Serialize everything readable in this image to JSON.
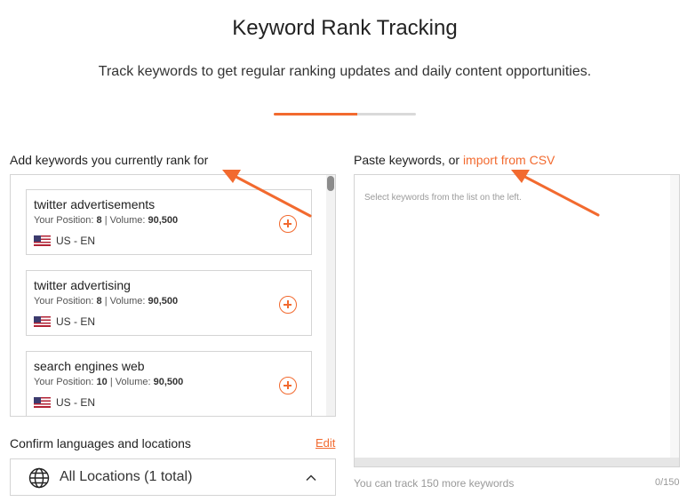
{
  "page": {
    "title": "Keyword Rank Tracking",
    "subtitle": "Track keywords to get regular ranking updates and daily content opportunities.",
    "progress_fraction": 0.59
  },
  "left": {
    "heading": "Add keywords you currently rank for",
    "keywords": [
      {
        "name": "twitter advertisements",
        "position_label": "Your Position:",
        "position": "8",
        "volume_label": "Volume:",
        "volume": "90,500",
        "locale": "US - EN"
      },
      {
        "name": "twitter advertising",
        "position_label": "Your Position:",
        "position": "8",
        "volume_label": "Volume:",
        "volume": "90,500",
        "locale": "US - EN"
      },
      {
        "name": "search engines web",
        "position_label": "Your Position:",
        "position": "10",
        "volume_label": "Volume:",
        "volume": "90,500",
        "locale": "US - EN"
      }
    ]
  },
  "right": {
    "heading_prefix": "Paste keywords, or ",
    "import_link": "import from CSV",
    "placeholder": "Select keywords from the list on the left.",
    "note": "You can track 150 more keywords",
    "counter": "0/150"
  },
  "locations": {
    "label": "Confirm languages and locations",
    "edit": "Edit",
    "selected": "All Locations (1 total)"
  },
  "colors": {
    "accent": "#f26a2f",
    "border": "#d4d4d4"
  }
}
